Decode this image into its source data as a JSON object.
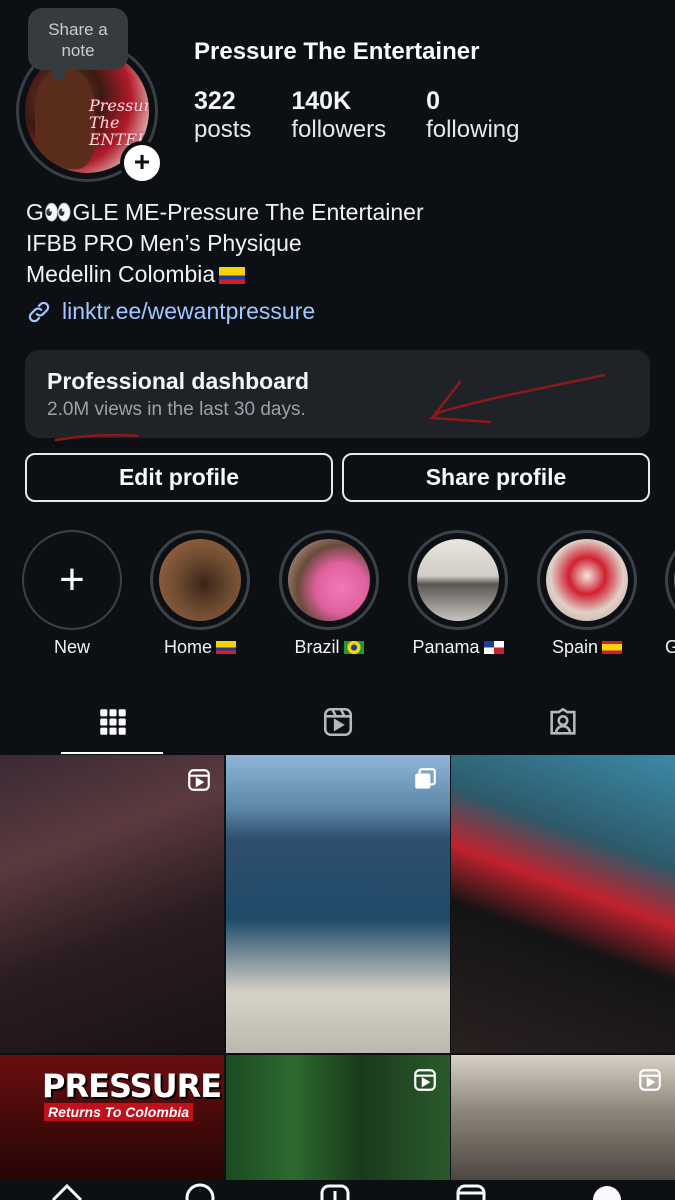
{
  "profile": {
    "note_label": "Share a\nnote",
    "avatar_text": "Pressure\nThe\nENTERTAINER",
    "username": "Pressure The Entertainer",
    "stats": [
      {
        "num": "322",
        "label": "posts"
      },
      {
        "num": "140K",
        "label": "followers"
      },
      {
        "num": "0",
        "label": "following"
      }
    ],
    "bio": [
      "G👀GLE ME-Pressure The Entertainer",
      "IFBB PRO Men’s Physique",
      "Medellin Colombia"
    ],
    "link": "linktr.ee/wewantpressure"
  },
  "dashboard": {
    "title": "Professional dashboard",
    "subtitle": "2.0M views in the last 30 days."
  },
  "buttons": {
    "edit": "Edit profile",
    "share": "Share profile"
  },
  "highlights": [
    {
      "label": "New"
    },
    {
      "label": "Home",
      "flag": "colombia"
    },
    {
      "label": "Brazil",
      "flag": "brazil"
    },
    {
      "label": "Panama",
      "flag": "panama"
    },
    {
      "label": "Spain",
      "flag": "spain"
    },
    {
      "label": "Ge"
    }
  ],
  "tabs": [
    {
      "icon": "grid-icon",
      "active": true
    },
    {
      "icon": "reels-icon",
      "active": false
    },
    {
      "icon": "tagged-icon",
      "active": false
    }
  ],
  "grid": {
    "poster_title": "PRESSURE",
    "poster_subtitle": "Returns To Colombia"
  },
  "colors": {
    "background": "#0c1014",
    "link": "#a3c7ff",
    "card": "#1f2327",
    "annotation": "#8a1a1a"
  }
}
